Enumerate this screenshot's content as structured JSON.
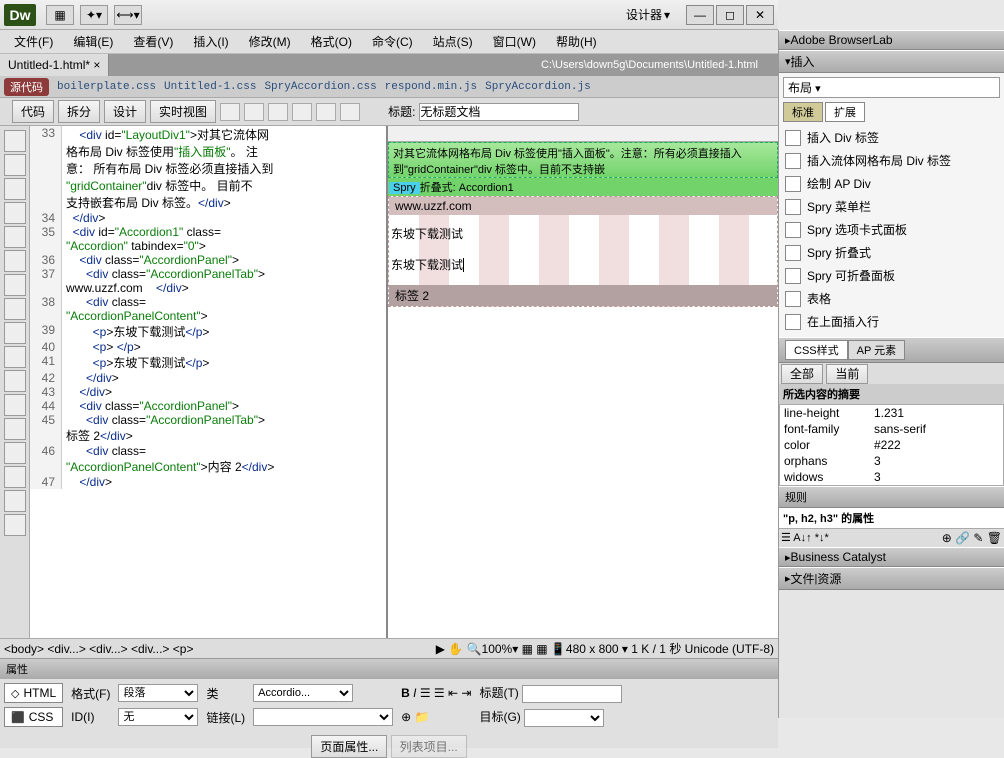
{
  "app": {
    "logo": "Dw",
    "designer_label": "设计器"
  },
  "menu": [
    "文件(F)",
    "编辑(E)",
    "查看(V)",
    "插入(I)",
    "修改(M)",
    "格式(O)",
    "命令(C)",
    "站点(S)",
    "窗口(W)",
    "帮助(H)"
  ],
  "tab": {
    "name": "Untitled-1.html*",
    "path": "C:\\Users\\down5g\\Documents\\Untitled-1.html"
  },
  "source_bar": {
    "label": "源代码",
    "files": [
      "boilerplate.css",
      "Untitled-1.css",
      "SpryAccordion.css",
      "respond.min.js",
      "SpryAccordion.js"
    ]
  },
  "view_buttons": [
    "代码",
    "拆分",
    "设计",
    "实时视图"
  ],
  "title_label": "标题:",
  "title_value": "无标题文档",
  "code": [
    {
      "n": "33",
      "t": "    <div id=\"LayoutDiv1\">对其它流体网"
    },
    {
      "n": "",
      "t": "格布局 Div 标签使用\"插入面板\"。 注"
    },
    {
      "n": "",
      "t": "意： 所有布局 Div 标签必须直接插入到"
    },
    {
      "n": "",
      "t": "\"gridContainer\"div 标签中。 目前不"
    },
    {
      "n": "",
      "t": "支持嵌套布局 Div 标签。</div>"
    },
    {
      "n": "34",
      "t": "  </div>"
    },
    {
      "n": "35",
      "t": "  <div id=\"Accordion1\" class="
    },
    {
      "n": "",
      "t": "\"Accordion\" tabindex=\"0\">"
    },
    {
      "n": "36",
      "t": "    <div class=\"AccordionPanel\">"
    },
    {
      "n": "37",
      "t": "      <div class=\"AccordionPanelTab\">"
    },
    {
      "n": "",
      "t": "www.uzzf.com    </div>"
    },
    {
      "n": "38",
      "t": "      <div class="
    },
    {
      "n": "",
      "t": "\"AccordionPanelContent\">"
    },
    {
      "n": "39",
      "t": "        <p>东坡下载测试</p>"
    },
    {
      "n": "40",
      "t": "        <p>&nbsp;</p>"
    },
    {
      "n": "41",
      "t": "        <p>东坡下载测试</p>"
    },
    {
      "n": "42",
      "t": "      </div>"
    },
    {
      "n": "43",
      "t": "    </div>"
    },
    {
      "n": "44",
      "t": "    <div class=\"AccordionPanel\">"
    },
    {
      "n": "45",
      "t": "      <div class=\"AccordionPanelTab\">"
    },
    {
      "n": "",
      "t": "标签 2</div>"
    },
    {
      "n": "46",
      "t": "      <div class="
    },
    {
      "n": "",
      "t": "\"AccordionPanelContent\">内容 2</div>"
    },
    {
      "n": "47",
      "t": "    </div>"
    }
  ],
  "design": {
    "green_text": "对其它流体网格布局 Div 标签使用\"插入面板\"。注意：所有必须直接插入到\"gridContainer\"div 标签中。目前不支持嵌",
    "spry_label": "Spry",
    "spry_name": "折叠式: Accordion1",
    "tab1": "www.uzzf.com",
    "content1a": "东坡下载测试",
    "content1b": "东坡下载测试",
    "tab2": "标签 2"
  },
  "status": {
    "breadcrumb": "<body> <div...> <div...> <div...> <p>",
    "zoom": "100%",
    "info": "480 x 800 ▾ 1 K / 1 秒 Unicode (UTF-8)"
  },
  "props": {
    "header": "属性",
    "html_btn": "HTML",
    "css_btn": "CSS",
    "format_lbl": "格式(F)",
    "format_val": "段落",
    "class_lbl": "类",
    "class_val": "Accordio...",
    "id_lbl": "ID(I)",
    "id_val": "无",
    "link_lbl": "链接(L)",
    "title_lbl": "标题(T)",
    "target_lbl": "目标(G)",
    "pageprops": "页面属性...",
    "listprops": "列表项目..."
  },
  "panels": {
    "browserlab": "Adobe BrowserLab",
    "insert": "插入",
    "insert_cat": "布局",
    "insert_tabs": [
      "标准",
      "扩展"
    ],
    "insert_items": [
      "插入 Div 标签",
      "插入流体网格布局 Div 标签",
      "绘制 AP Div",
      "Spry 菜单栏",
      "Spry 选项卡式面板",
      "Spry 折叠式",
      "Spry 可折叠面板",
      "表格",
      "在上面插入行"
    ],
    "css_header": "CSS样式",
    "ap_header": "AP 元素",
    "css_filters": [
      "全部",
      "当前"
    ],
    "css_summary": "所选内容的摘要",
    "css_props": [
      {
        "p": "line-height",
        "v": "1.231"
      },
      {
        "p": "font-family",
        "v": "sans-serif"
      },
      {
        "p": "color",
        "v": "#222"
      },
      {
        "p": "orphans",
        "v": "3"
      },
      {
        "p": "widows",
        "v": "3"
      }
    ],
    "rules": "规则",
    "rules_text": "\"p, h2, h3\" 的属性",
    "business": "Business Catalyst",
    "files": "文件",
    "assets": "资源"
  }
}
